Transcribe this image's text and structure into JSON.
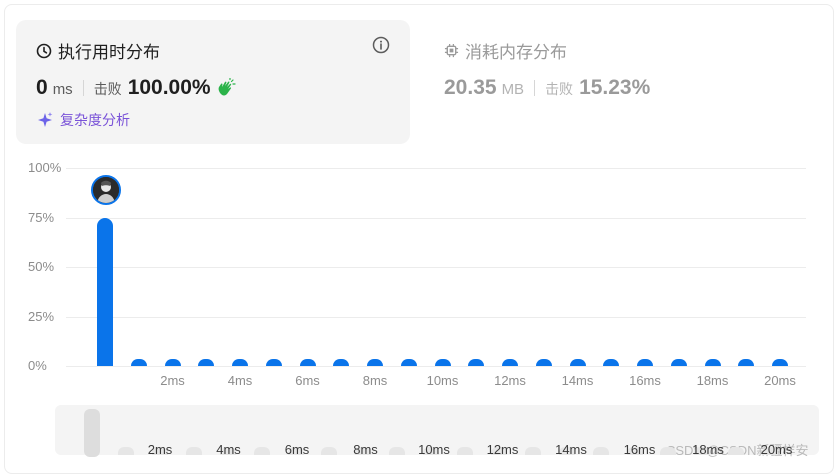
{
  "runtime": {
    "title": "执行用时分布",
    "value": "0",
    "unit": "ms",
    "beat_label": "击败",
    "beat_value": "100.00%",
    "analysis_label": "复杂度分析"
  },
  "memory": {
    "title": "消耗内存分布",
    "value": "20.35",
    "unit": "MB",
    "beat_label": "击败",
    "beat_value": "15.23%"
  },
  "colors": {
    "bar": "#0a74ea",
    "analysis": "#7a53d8",
    "clap": "#2bb34a"
  },
  "chart_data": {
    "type": "bar",
    "y_tick_labels": [
      "100%",
      "75%",
      "50%",
      "25%",
      "0%"
    ],
    "ylim": [
      0,
      100
    ],
    "categories": [
      "0ms",
      "1ms",
      "2ms",
      "3ms",
      "4ms",
      "5ms",
      "6ms",
      "7ms",
      "8ms",
      "9ms",
      "10ms",
      "11ms",
      "12ms",
      "13ms",
      "14ms",
      "15ms",
      "16ms",
      "17ms",
      "18ms",
      "19ms",
      "20ms"
    ],
    "values": [
      74.5,
      0,
      0,
      0,
      0,
      0,
      0,
      0,
      0,
      0,
      0,
      0,
      0,
      0,
      0,
      0,
      0,
      0,
      0,
      0,
      0
    ],
    "x_tick_labels": [
      "2ms",
      "4ms",
      "6ms",
      "8ms",
      "10ms",
      "12ms",
      "14ms",
      "16ms",
      "18ms",
      "20ms"
    ],
    "grid": true,
    "marker_on": "0ms"
  },
  "range_ticks": [
    "2ms",
    "4ms",
    "6ms",
    "8ms",
    "10ms",
    "12ms",
    "14ms",
    "16ms",
    "18ms",
    "20ms"
  ],
  "watermark": "CSDN @CSDN新疆样安"
}
